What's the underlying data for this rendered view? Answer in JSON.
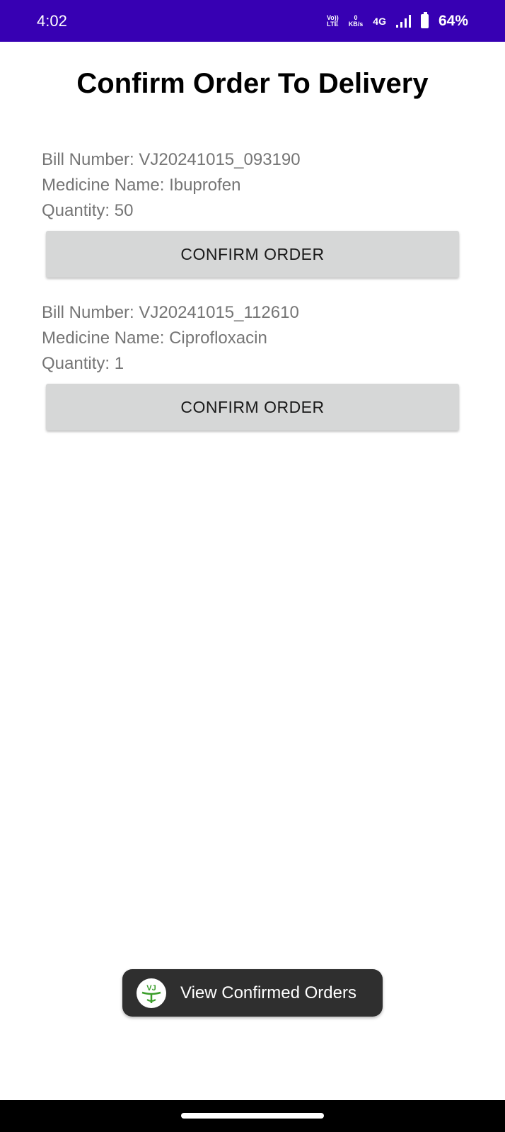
{
  "status_bar": {
    "time": "4:02",
    "volte_top": "Vo))",
    "volte_bottom": "LTE",
    "speed_value": "0",
    "speed_unit": "KB/s",
    "network": "4G",
    "battery": "64%"
  },
  "page": {
    "title": "Confirm Order To Delivery"
  },
  "orders": [
    {
      "bill": "Bill Number: VJ20241015_093190",
      "medicine": "Medicine Name: Ibuprofen",
      "quantity": "Quantity: 50",
      "button_label": "CONFIRM ORDER"
    },
    {
      "bill": "Bill Number: VJ20241015_112610",
      "medicine": "Medicine Name: Ciprofloxacin",
      "quantity": "Quantity: 1",
      "button_label": "CONFIRM ORDER"
    }
  ],
  "toast": {
    "logo_text": "VJ",
    "message": "View Confirmed Orders"
  },
  "colors": {
    "status_bar": "#3700b3",
    "button_bg": "#d6d7d7",
    "detail_text": "#757575",
    "toast_bg": "#2f2f2f",
    "logo_green": "#3a9d2a"
  },
  "icons": [
    "volte-icon",
    "signal-icon",
    "battery-icon",
    "app-logo-icon"
  ]
}
